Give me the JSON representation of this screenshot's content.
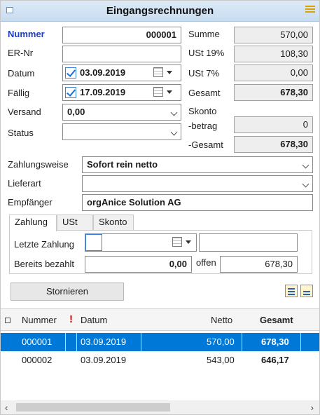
{
  "window": {
    "title": "Eingangsrechnungen"
  },
  "form": {
    "nummer_label": "Nummer",
    "nummer_value": "000001",
    "ernr_label": "ER-Nr",
    "ernr_value": "",
    "datum_label": "Datum",
    "datum_value": "03.09.2019",
    "faellig_label": "Fällig",
    "faellig_value": "17.09.2019",
    "versand_label": "Versand",
    "versand_value": "0,00",
    "status_label": "Status",
    "status_value": "",
    "summe_label": "Summe",
    "summe_value": "570,00",
    "ust19_label": "USt 19%",
    "ust19_value": "108,30",
    "ust7_label": "USt  7%",
    "ust7_value": "0,00",
    "gesamt_label": "Gesamt",
    "gesamt_value": "678,30",
    "skonto_label": "Skonto",
    "skonto_betrag_label": "-betrag",
    "skonto_betrag_value": "0",
    "skonto_gesamt_label": "-Gesamt",
    "skonto_gesamt_value": "678,30",
    "zahlungsweise_label": "Zahlungsweise",
    "zahlungsweise_value": "Sofort rein netto",
    "lieferart_label": "Lieferart",
    "lieferart_value": "",
    "empfaenger_label": "Empfänger",
    "empfaenger_value": "orgAnice Solution AG"
  },
  "tabs": [
    {
      "label": "Zahlung",
      "active": true
    },
    {
      "label": "USt",
      "active": false
    },
    {
      "label": "Skonto",
      "active": false
    }
  ],
  "zahlung": {
    "letzte_label": "Letzte Zahlung",
    "letzte_date": "",
    "letzte_extra": "",
    "bezahlt_label": "Bereits bezahlt",
    "bezahlt_value": "0,00",
    "offen_label": "offen",
    "offen_value": "678,30"
  },
  "actions": {
    "stornieren_label": "Stornieren"
  },
  "table": {
    "headers": {
      "nummer": "Nummer",
      "flag": "!",
      "datum": "Datum",
      "netto": "Netto",
      "gesamt": "Gesamt"
    },
    "rows": [
      {
        "nummer": "000001",
        "datum": "03.09.2019",
        "netto": "570,00",
        "gesamt": "678,30",
        "selected": true
      },
      {
        "nummer": "000002",
        "datum": "03.09.2019",
        "netto": "543,00",
        "gesamt": "646,17",
        "selected": false
      }
    ]
  },
  "colors": {
    "accent": "#0078d7",
    "label_blue": "#1f3fbf",
    "flag_red": "#d40000"
  },
  "icons": {
    "system": "window-icon",
    "menu": "menu-icon",
    "calendar": "calendar-icon",
    "export": "export-icon",
    "import": "import-icon"
  }
}
